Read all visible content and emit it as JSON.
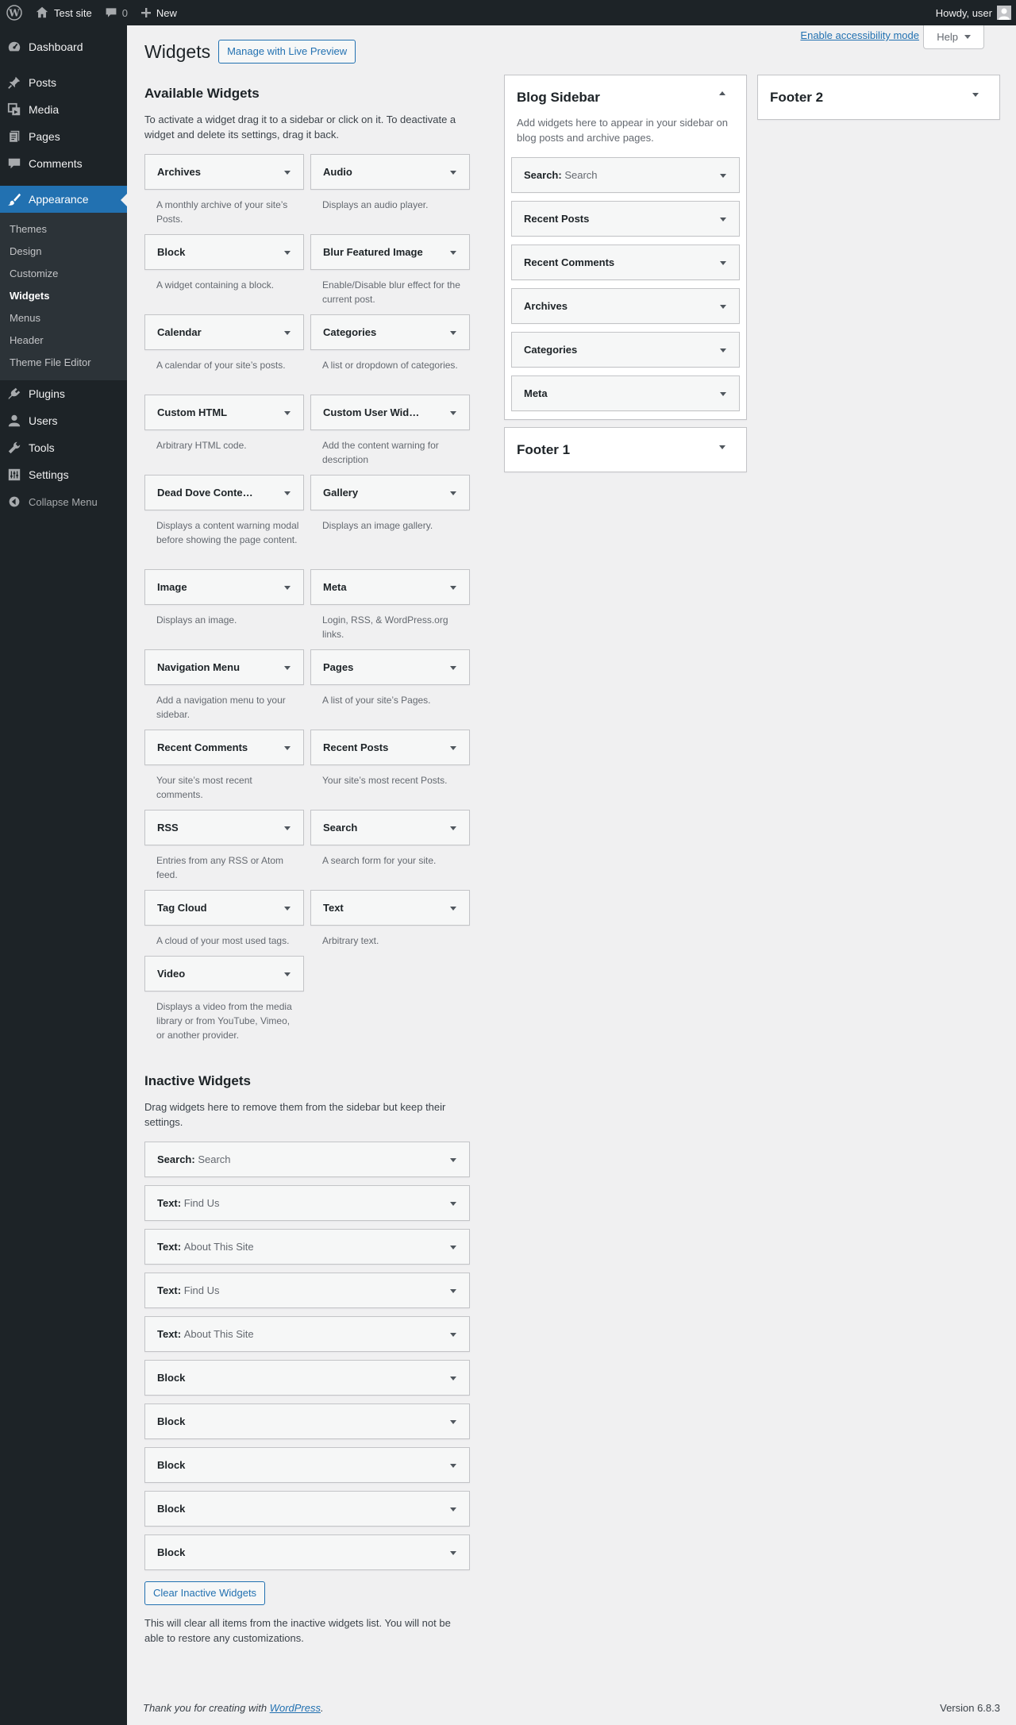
{
  "adminbar": {
    "site_name": "Test site",
    "comments_count": "0",
    "new_label": "New",
    "howdy": "Howdy, user"
  },
  "menu": {
    "dashboard": "Dashboard",
    "posts": "Posts",
    "media": "Media",
    "pages": "Pages",
    "comments": "Comments",
    "appearance": "Appearance",
    "submenu": [
      "Themes",
      "Design",
      "Customize",
      "Widgets",
      "Menus",
      "Header",
      "Theme File Editor"
    ],
    "plugins": "Plugins",
    "users": "Users",
    "tools": "Tools",
    "settings": "Settings",
    "collapse": "Collapse Menu"
  },
  "header": {
    "title": "Widgets",
    "live_preview": "Manage with Live Preview",
    "accessibility": "Enable accessibility mode",
    "help": "Help"
  },
  "available": {
    "title": "Available Widgets",
    "description": "To activate a widget drag it to a sidebar or click on it. To deactivate a widget and delete its settings, drag it back.",
    "widgets": [
      {
        "name": "Archives",
        "desc": "A monthly archive of your site’s Posts."
      },
      {
        "name": "Audio",
        "desc": "Displays an audio player."
      },
      {
        "name": "Block",
        "desc": "A widget containing a block."
      },
      {
        "name": "Blur Featured Image",
        "desc": "Enable/Disable blur effect for the current post."
      },
      {
        "name": "Calendar",
        "desc": "A calendar of your site’s posts."
      },
      {
        "name": "Categories",
        "desc": "A list or dropdown of categories."
      },
      {
        "name": "Custom HTML",
        "desc": "Arbitrary HTML code."
      },
      {
        "name": "Custom User Wid…",
        "desc": "Add the content warning for description"
      },
      {
        "name": "Dead Dove Conte…",
        "desc": "Displays a content warning modal before showing the page content."
      },
      {
        "name": "Gallery",
        "desc": "Displays an image gallery."
      },
      {
        "name": "Image",
        "desc": "Displays an image."
      },
      {
        "name": "Meta",
        "desc": "Login, RSS, & WordPress.org links."
      },
      {
        "name": "Navigation Menu",
        "desc": "Add a navigation menu to your sidebar."
      },
      {
        "name": "Pages",
        "desc": "A list of your site’s Pages."
      },
      {
        "name": "Recent Comments",
        "desc": "Your site’s most recent comments."
      },
      {
        "name": "Recent Posts",
        "desc": "Your site’s most recent Posts."
      },
      {
        "name": "RSS",
        "desc": "Entries from any RSS or Atom feed."
      },
      {
        "name": "Search",
        "desc": "A search form for your site."
      },
      {
        "name": "Tag Cloud",
        "desc": "A cloud of your most used tags."
      },
      {
        "name": "Text",
        "desc": "Arbitrary text."
      },
      {
        "name": "Video",
        "desc": "Displays a video from the media library or from YouTube, Vimeo, or another provider."
      }
    ]
  },
  "inactive": {
    "title": "Inactive Widgets",
    "description": "Drag widgets here to remove them from the sidebar but keep their settings.",
    "widgets": [
      {
        "name": "Search",
        "title": "Search"
      },
      {
        "name": "Text",
        "title": "Find Us"
      },
      {
        "name": "Text",
        "title": "About This Site"
      },
      {
        "name": "Text",
        "title": "Find Us"
      },
      {
        "name": "Text",
        "title": "About This Site"
      },
      {
        "name": "Block",
        "title": ""
      },
      {
        "name": "Block",
        "title": ""
      },
      {
        "name": "Block",
        "title": ""
      },
      {
        "name": "Block",
        "title": ""
      },
      {
        "name": "Block",
        "title": ""
      }
    ],
    "clear_button": "Clear Inactive Widgets",
    "clear_note": "This will clear all items from the inactive widgets list. You will not be able to restore any customizations."
  },
  "sidebars": {
    "blog": {
      "name": "Blog Sidebar",
      "description": "Add widgets here to appear in your sidebar on blog posts and archive pages.",
      "widgets": [
        {
          "name": "Search",
          "title": "Search"
        },
        {
          "name": "Recent Posts",
          "title": ""
        },
        {
          "name": "Recent Comments",
          "title": ""
        },
        {
          "name": "Archives",
          "title": ""
        },
        {
          "name": "Categories",
          "title": ""
        },
        {
          "name": "Meta",
          "title": ""
        }
      ]
    },
    "footer1": {
      "name": "Footer 1"
    },
    "footer2": {
      "name": "Footer 2"
    }
  },
  "footer": {
    "thanks_prefix": "Thank you for creating with ",
    "thanks_link": "WordPress",
    "thanks_suffix": ".",
    "version": "Version 6.8.3"
  },
  "colors": {
    "admin_bar": "#1d2327",
    "menu_current": "#2271b1",
    "submenu_bg": "#2c3338",
    "link": "#2271b1",
    "page_bg": "#f0f0f1"
  }
}
